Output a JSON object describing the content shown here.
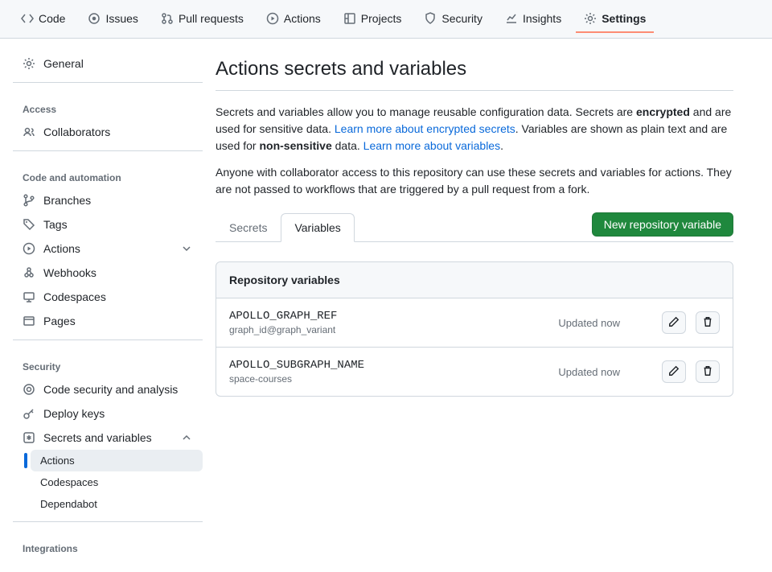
{
  "topnav": [
    {
      "icon": "code",
      "label": "Code"
    },
    {
      "icon": "issues",
      "label": "Issues"
    },
    {
      "icon": "pr",
      "label": "Pull requests"
    },
    {
      "icon": "play",
      "label": "Actions"
    },
    {
      "icon": "projects",
      "label": "Projects"
    },
    {
      "icon": "shield",
      "label": "Security"
    },
    {
      "icon": "graph",
      "label": "Insights"
    },
    {
      "icon": "gear",
      "label": "Settings",
      "active": true
    }
  ],
  "sidebar": {
    "general": "General",
    "groups": [
      {
        "head": "Access",
        "items": [
          {
            "icon": "people",
            "label": "Collaborators"
          }
        ]
      },
      {
        "head": "Code and automation",
        "items": [
          {
            "icon": "branch",
            "label": "Branches"
          },
          {
            "icon": "tag",
            "label": "Tags"
          },
          {
            "icon": "play",
            "label": "Actions",
            "chev": true
          },
          {
            "icon": "webhook",
            "label": "Webhooks"
          },
          {
            "icon": "codespaces",
            "label": "Codespaces"
          },
          {
            "icon": "browser",
            "label": "Pages"
          }
        ]
      },
      {
        "head": "Security",
        "items": [
          {
            "icon": "scan",
            "label": "Code security and analysis"
          },
          {
            "icon": "key",
            "label": "Deploy keys"
          },
          {
            "icon": "asterisk",
            "label": "Secrets and variables",
            "chev": true,
            "expanded": true,
            "sub": [
              {
                "label": "Actions",
                "selected": true
              },
              {
                "label": "Codespaces"
              },
              {
                "label": "Dependabot"
              }
            ]
          }
        ]
      },
      {
        "head": "Integrations",
        "items": []
      }
    ]
  },
  "page": {
    "title": "Actions secrets and variables",
    "p1a": "Secrets and variables allow you to manage reusable configuration data. Secrets are ",
    "p1b": "encrypted",
    "p1c": " and are used for sensitive data. ",
    "link1": "Learn more about encrypted secrets",
    "p1d": ". Variables are shown as plain text and are used for ",
    "p1e": "non-sensitive",
    "p1f": " data. ",
    "link2": "Learn more about variables",
    "p1g": ".",
    "p2": "Anyone with collaborator access to this repository can use these secrets and variables for actions. They are not passed to workflows that are triggered by a pull request from a fork.",
    "tabs": {
      "secrets": "Secrets",
      "variables": "Variables"
    },
    "new_btn": "New repository variable",
    "panel_head": "Repository variables",
    "rows": [
      {
        "name": "APOLLO_GRAPH_REF",
        "val": "graph_id@graph_variant",
        "updated": "Updated now"
      },
      {
        "name": "APOLLO_SUBGRAPH_NAME",
        "val": "space-courses",
        "updated": "Updated now"
      }
    ]
  }
}
